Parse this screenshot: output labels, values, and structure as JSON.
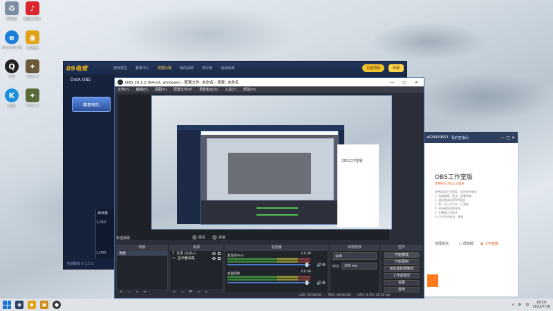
{
  "desktop": {
    "icons": [
      {
        "label": "回收站",
        "glyph": "♻",
        "color": "#7d8ea3"
      },
      {
        "label": "Microsoft Edge",
        "glyph": "e",
        "color": "#1e7fd6"
      },
      {
        "label": "QQ",
        "glyph": "Q",
        "color": "#222222"
      },
      {
        "label": "酷狗",
        "glyph": "K",
        "color": "#1a8fe0"
      },
      {
        "label": "网易云音乐",
        "glyph": "♪",
        "color": "#d9262e"
      },
      {
        "label": "09电竞",
        "glyph": "◉",
        "color": "#e0a318"
      },
      {
        "label": "Dota 2",
        "glyph": "✦",
        "color": "#6b5a3a"
      },
      {
        "label": "Dota 2",
        "glyph": "✦",
        "color": "#5a6b3a"
      }
    ]
  },
  "game_client": {
    "logo": "09电竞",
    "nav": [
      "游戏排位",
      "赛事中心",
      "我要比赛",
      "我的战绩",
      "排行榜",
      "道具商城"
    ],
    "active_nav": "我要比赛",
    "btn_recharge": "充值领取",
    "btn_mall": "商城",
    "sidebar_title": "DotA OBS",
    "badge": "赛事预约",
    "version": "当前版本 V 1.1.1",
    "plus": "+",
    "chart": {
      "label": "推荐赛",
      "v1": "1,010",
      "v2": "1,000"
    }
  },
  "studio": {
    "user_id": "a624469653",
    "link": "我的直播间",
    "controls": "— □ ×",
    "title": "OBS工作室版",
    "subtitle": "适用Win7及以上版本",
    "lines": [
      "免费OBS工作室版，仅供参考使用",
      "1. 电脑摄像、麦克、屏幕采集",
      "2. 通过推流码RTMP直播",
      "3. 第一次上手打开，已减弱",
      "4. 支持更多效果滤镜",
      "5. 开播请点击推流",
      "6. 已对开启推流，备播"
    ],
    "radio_label": "选择版本：",
    "radio_a": "○ 经典版",
    "radio_b": "◉ 工作室版"
  },
  "obs": {
    "title": "OBS 26.1.1 (64-bit, windows) - 配置文件: 未命名 - 场景: 未命名",
    "win_controls": [
      "—",
      "□",
      "✕"
    ],
    "menu": [
      "文件(F)",
      "编辑(E)",
      "视图(V)",
      "配置文件(P)",
      "场景集合(S)",
      "工具(T)",
      "帮助(H)"
    ],
    "scene_label": "未选择源",
    "tab_props": "属性",
    "tab_filters": "滤镜",
    "docks": {
      "scenes": "场景",
      "sources": "来源",
      "mixer": "混音器",
      "transitions": "转场特效",
      "controls": "控件"
    },
    "scenes": [
      "场景"
    ],
    "sources": [
      "文本 (GDI+)",
      "显示器采集"
    ],
    "mixer": [
      {
        "name": "麦克风/Aux",
        "db": "0.0 dB"
      },
      {
        "name": "桌面音频",
        "db": "0.0 dB"
      }
    ],
    "transition": {
      "name": "淡出",
      "duration_label": "时长",
      "duration": "300 ms"
    },
    "controls": [
      "开始推流",
      "开始录制",
      "启动虚拟摄像机",
      "工作室模式",
      "设置",
      "退出"
    ],
    "status": [
      "LIVE: 00:00:00",
      "REC: 00:00:00",
      "CPU: 0.1%, 30.00 fps"
    ]
  },
  "preview": {
    "studio_title": "OBS工作室版"
  },
  "taskbar": {
    "time": "18:16",
    "date": "2022/7/16",
    "tray": [
      "∧",
      "🔊",
      "中"
    ]
  }
}
